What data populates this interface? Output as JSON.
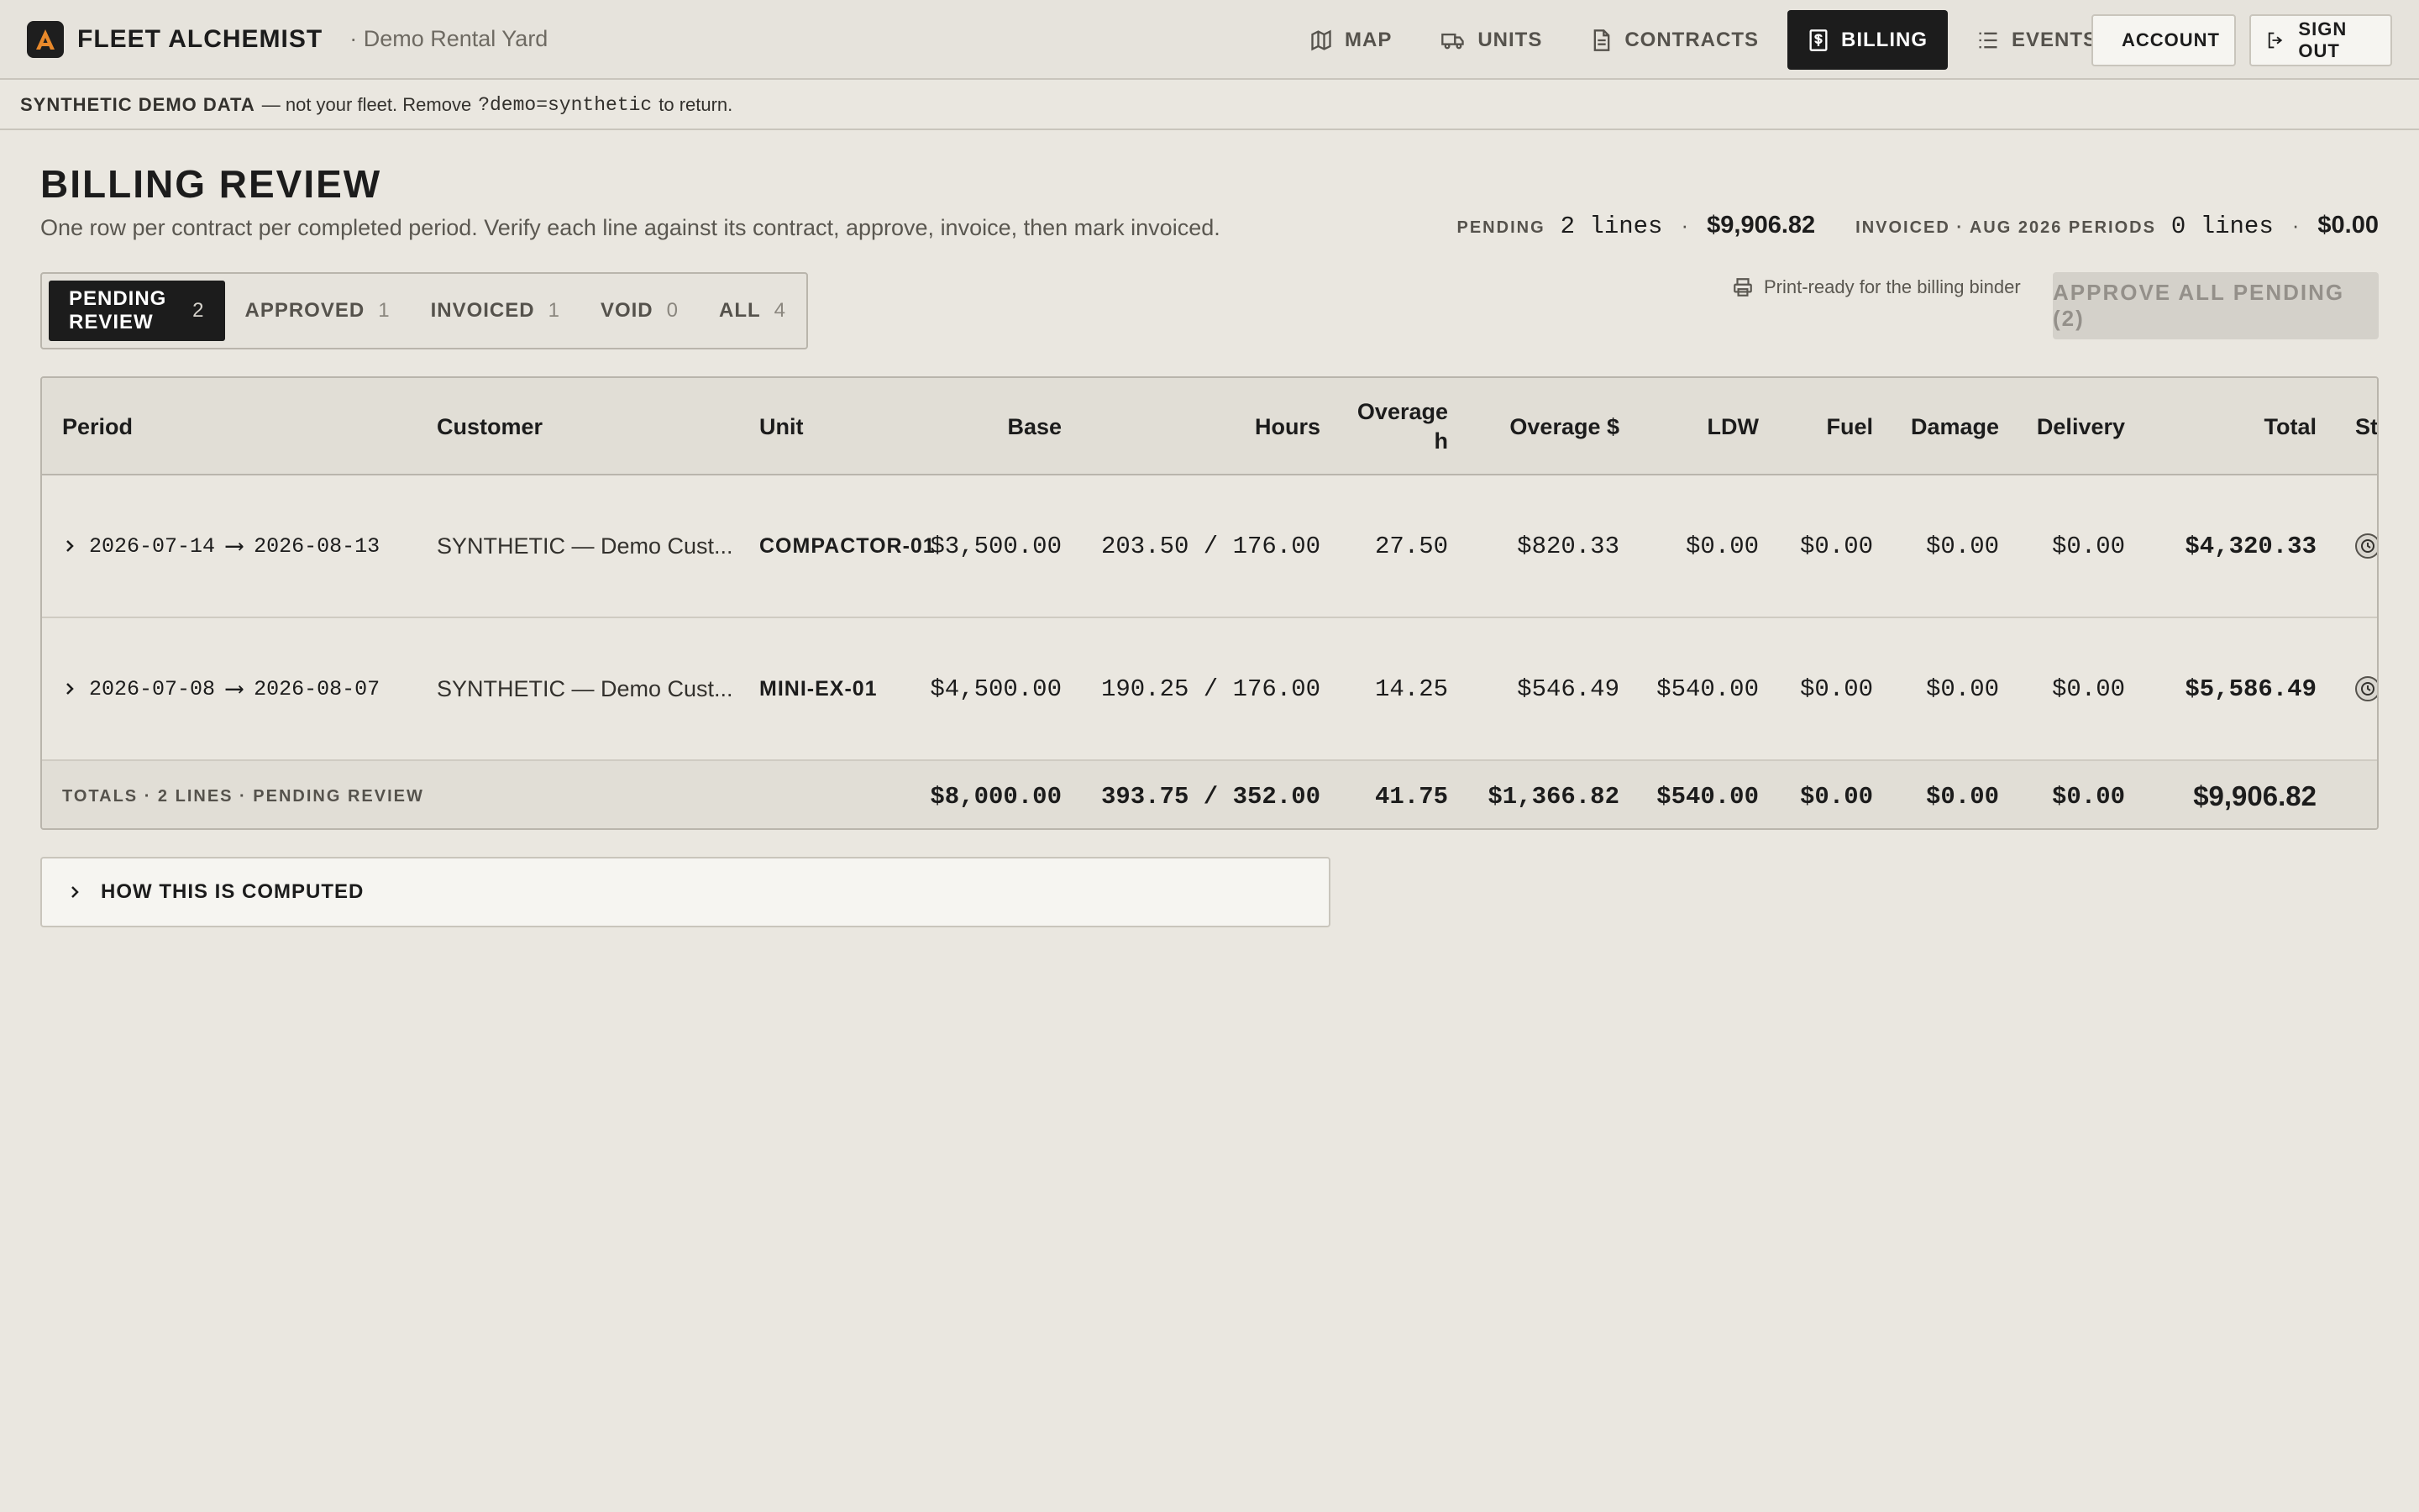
{
  "app": {
    "name": "FLEET ALCHEMIST",
    "yard": "· Demo Rental Yard",
    "accent_color": "#e8892b"
  },
  "nav": {
    "items": [
      {
        "label": "MAP",
        "icon": "map-icon"
      },
      {
        "label": "UNITS",
        "icon": "truck-icon"
      },
      {
        "label": "CONTRACTS",
        "icon": "document-icon"
      },
      {
        "label": "BILLING",
        "icon": "invoice-icon",
        "active": true
      },
      {
        "label": "EVENTS",
        "icon": "list-icon"
      }
    ],
    "account_label": "ACCOUNT",
    "signout_label": "SIGN OUT"
  },
  "banner": {
    "strong": "SYNTHETIC DEMO DATA",
    "text_before": "— not your fleet. Remove",
    "code": "?demo=synthetic",
    "text_after": "to return."
  },
  "header": {
    "title": "BILLING REVIEW",
    "subtitle": "One row per contract per completed period. Verify each line against its contract, approve, invoice, then mark invoiced."
  },
  "summary": {
    "pending_label": "PENDING",
    "pending_count": "2 lines",
    "pending_amount": "$9,906.82",
    "invoiced_label": "INVOICED · AUG 2026 PERIODS",
    "invoiced_count": "0 lines",
    "invoiced_amount": "$0.00",
    "separator": "·"
  },
  "tabs": [
    {
      "label": "PENDING REVIEW",
      "count": "2",
      "active": true
    },
    {
      "label": "APPROVED",
      "count": "1"
    },
    {
      "label": "INVOICED",
      "count": "1"
    },
    {
      "label": "VOID",
      "count": "0"
    },
    {
      "label": "ALL",
      "count": "4"
    }
  ],
  "print_note": "Print-ready for the billing binder",
  "approve_all_label": "APPROVE ALL PENDING (2)",
  "table": {
    "columns": {
      "period": "Period",
      "customer": "Customer",
      "unit": "Unit",
      "base": "Base",
      "hours": "Hours",
      "overage_h_1": "Overage",
      "overage_h_2": "h",
      "overage_usd": "Overage $",
      "ldw": "LDW",
      "fuel": "Fuel",
      "damage": "Damage",
      "delivery": "Delivery",
      "total": "Total",
      "status": "St"
    },
    "rows": [
      {
        "period_start": "2026-07-14",
        "period_arrow": "⟶",
        "period_end": "2026-08-13",
        "customer": "SYNTHETIC — Demo Cust...",
        "unit": "COMPACTOR-01",
        "base": "$3,500.00",
        "hours": "203.50 / 176.00",
        "overage_h": "27.50",
        "overage_usd": "$820.33",
        "ldw": "$0.00",
        "fuel": "$0.00",
        "damage": "$0.00",
        "delivery": "$0.00",
        "total": "$4,320.33",
        "status_icon": "clock-icon"
      },
      {
        "period_start": "2026-07-08",
        "period_arrow": "⟶",
        "period_end": "2026-08-07",
        "customer": "SYNTHETIC — Demo Cust...",
        "unit": "MINI-EX-01",
        "base": "$4,500.00",
        "hours": "190.25 / 176.00",
        "overage_h": "14.25",
        "overage_usd": "$546.49",
        "ldw": "$540.00",
        "fuel": "$0.00",
        "damage": "$0.00",
        "delivery": "$0.00",
        "total": "$5,586.49",
        "status_icon": "clock-icon"
      }
    ],
    "totals": {
      "label": "TOTALS · 2 LINES · PENDING REVIEW",
      "base": "$8,000.00",
      "hours": "393.75 / 352.00",
      "overage_h": "41.75",
      "overage_usd": "$1,366.82",
      "ldw": "$540.00",
      "fuel": "$0.00",
      "damage": "$0.00",
      "delivery": "$0.00",
      "total": "$9,906.82"
    }
  },
  "how_computed_label": "HOW THIS IS COMPUTED"
}
